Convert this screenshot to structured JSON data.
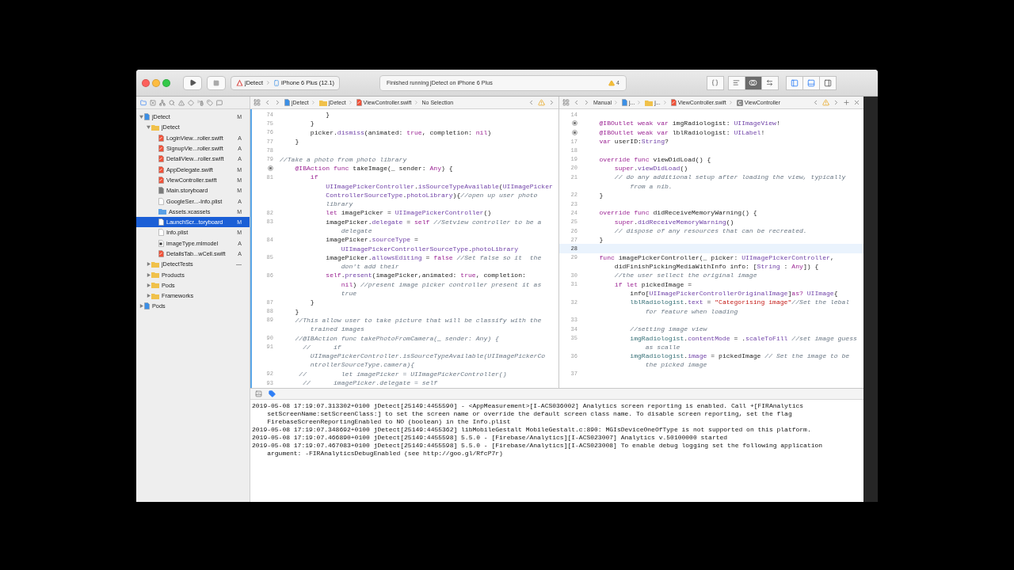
{
  "toolbar": {
    "scheme": "jDetect",
    "device": "iPhone 6 Plus (12.1)",
    "status": "Finished running jDetect on iPhone 6 Plus",
    "warnings": "4",
    "editor_modes": [
      {
        "kind": "standard",
        "selected": false
      },
      {
        "kind": "assistant",
        "selected": true
      },
      {
        "kind": "version",
        "selected": false
      }
    ],
    "panels": [
      {
        "kind": "navigator",
        "selected": true
      },
      {
        "kind": "debug",
        "selected": true
      },
      {
        "kind": "inspector",
        "selected": false
      }
    ]
  },
  "navigator": {
    "tabs": [
      {
        "kind": "project",
        "selected": true
      },
      {
        "kind": "source",
        "selected": false
      },
      {
        "kind": "symbol",
        "selected": false
      },
      {
        "kind": "find",
        "selected": false
      },
      {
        "kind": "issue",
        "selected": false
      },
      {
        "kind": "test",
        "selected": false
      },
      {
        "kind": "debug",
        "selected": false
      },
      {
        "kind": "breakpoint",
        "selected": false
      },
      {
        "kind": "report",
        "selected": false
      }
    ],
    "tree": [
      {
        "name": "jDetect",
        "kind": "project",
        "badge": "M",
        "expanded": true,
        "selected": false,
        "children": [
          {
            "name": "jDetect",
            "kind": "folder",
            "expanded": true,
            "selected": false,
            "children": [
              {
                "name": "LoginView...roller.swift",
                "kind": "swift",
                "badge": "A",
                "selected": false
              },
              {
                "name": "SignupVie...roller.swift",
                "kind": "swift",
                "badge": "A",
                "selected": false
              },
              {
                "name": "DetailView...roller.swift",
                "kind": "swift",
                "badge": "A",
                "selected": false
              },
              {
                "name": "AppDelegate.swift",
                "kind": "swift",
                "badge": "M",
                "selected": false
              },
              {
                "name": "ViewController.swift",
                "kind": "swift",
                "badge": "M",
                "selected": false
              },
              {
                "name": "Main.storyboard",
                "kind": "storyboard",
                "badge": "M",
                "selected": false
              },
              {
                "name": "GoogleSer...-Info.plist",
                "kind": "plist",
                "badge": "A",
                "selected": false
              },
              {
                "name": "Assets.xcassets",
                "kind": "assets",
                "badge": "M",
                "selected": false
              },
              {
                "name": "LaunchScr...toryboard",
                "kind": "plist",
                "badge": "M",
                "selected": true
              },
              {
                "name": "Info.plist",
                "kind": "plist",
                "badge": "M",
                "selected": false
              },
              {
                "name": "imageType.mlmodel",
                "kind": "mlmodel",
                "badge": "A",
                "selected": false
              },
              {
                "name": "DetailsTab...wCell.swift",
                "kind": "swift",
                "badge": "A",
                "selected": false
              }
            ]
          },
          {
            "name": "jDetectTests",
            "kind": "folder",
            "badge": "—",
            "expanded": false,
            "selected": false
          },
          {
            "name": "Products",
            "kind": "folder",
            "expanded": false,
            "selected": false
          },
          {
            "name": "Pods",
            "kind": "folder",
            "expanded": false,
            "selected": false
          },
          {
            "name": "Frameworks",
            "kind": "folder",
            "expanded": false,
            "selected": false
          }
        ]
      },
      {
        "name": "Pods",
        "kind": "project",
        "expanded": false,
        "selected": false
      }
    ]
  },
  "left_editor": {
    "jump_bar": [
      {
        "kind": "project",
        "label": "jDetect"
      },
      {
        "kind": "folder",
        "label": "jDetect"
      },
      {
        "kind": "swift",
        "label": "ViewController.swift"
      },
      {
        "kind": "none",
        "label": "No Selection"
      }
    ],
    "lines": [
      {
        "number": "74",
        "code": [
          {
            "kind": "p",
            "text": "            }"
          }
        ]
      },
      {
        "number": "75",
        "code": [
          {
            "kind": "p",
            "text": "        }"
          }
        ]
      },
      {
        "number": "76",
        "code": [
          {
            "kind": "p",
            "text": "        picker."
          },
          {
            "kind": "t",
            "text": "dismiss"
          },
          {
            "kind": "p",
            "text": "(animated: "
          },
          {
            "kind": "k",
            "text": "true"
          },
          {
            "kind": "p",
            "text": ", completion: "
          },
          {
            "kind": "k",
            "text": "nil"
          },
          {
            "kind": "p",
            "text": ")"
          }
        ]
      },
      {
        "number": "77",
        "code": [
          {
            "kind": "p",
            "text": "    }"
          }
        ]
      },
      {
        "number": "78"
      },
      {
        "number": "79",
        "code": [
          {
            "kind": "c",
            "text": "//Take a photo from photo library"
          }
        ]
      },
      {
        "kind": "outlet",
        "code": [
          {
            "kind": "k",
            "text": "    @IBAction func"
          },
          {
            "kind": "p",
            "text": " takeImage(_ sender: "
          },
          {
            "kind": "k",
            "text": "Any"
          },
          {
            "kind": "p",
            "text": ") {"
          }
        ]
      },
      {
        "number": "81",
        "code": [
          {
            "kind": "k",
            "text": "        if"
          }
        ]
      },
      {
        "code": [
          {
            "kind": "t",
            "text": "            UIImagePickerController"
          },
          {
            "kind": "p",
            "text": "."
          },
          {
            "kind": "t",
            "text": "isSourceTypeAvailable"
          },
          {
            "kind": "p",
            "text": "("
          },
          {
            "kind": "t",
            "text": "UIImagePicker"
          }
        ]
      },
      {
        "code": [
          {
            "kind": "t",
            "text": "            ControllerSourceType"
          },
          {
            "kind": "p",
            "text": "."
          },
          {
            "kind": "t",
            "text": "photoLibrary"
          },
          {
            "kind": "p",
            "text": "){"
          },
          {
            "kind": "c",
            "text": "//open up user photo"
          }
        ]
      },
      {
        "code": [
          {
            "kind": "c",
            "text": "            library"
          }
        ]
      },
      {
        "number": "82",
        "code": [
          {
            "kind": "k",
            "text": "            let"
          },
          {
            "kind": "p",
            "text": " imagePicker = "
          },
          {
            "kind": "t",
            "text": "UIImagePickerController"
          },
          {
            "kind": "p",
            "text": "()"
          }
        ]
      },
      {
        "number": "83",
        "code": [
          {
            "kind": "p",
            "text": "            imagePicker."
          },
          {
            "kind": "t",
            "text": "delegate"
          },
          {
            "kind": "p",
            "text": " = "
          },
          {
            "kind": "k",
            "text": "self"
          },
          {
            "kind": "c",
            "text": " //Setview controller to be a"
          }
        ]
      },
      {
        "code": [
          {
            "kind": "c",
            "text": "                delegate"
          }
        ]
      },
      {
        "number": "84",
        "code": [
          {
            "kind": "p",
            "text": "            imagePicker."
          },
          {
            "kind": "t",
            "text": "sourceType"
          },
          {
            "kind": "p",
            "text": " ="
          }
        ]
      },
      {
        "code": [
          {
            "kind": "t",
            "text": "                UIImagePickerControllerSourceType"
          },
          {
            "kind": "p",
            "text": "."
          },
          {
            "kind": "t",
            "text": "photoLibrary"
          }
        ]
      },
      {
        "number": "85",
        "code": [
          {
            "kind": "p",
            "text": "            imagePicker."
          },
          {
            "kind": "t",
            "text": "allowsEditing"
          },
          {
            "kind": "p",
            "text": " = "
          },
          {
            "kind": "k",
            "text": "false"
          },
          {
            "kind": "c",
            "text": " //Set false so it  the"
          }
        ]
      },
      {
        "code": [
          {
            "kind": "c",
            "text": "                don't add their"
          }
        ]
      },
      {
        "number": "86",
        "code": [
          {
            "kind": "k",
            "text": "            self"
          },
          {
            "kind": "p",
            "text": "."
          },
          {
            "kind": "t",
            "text": "present"
          },
          {
            "kind": "p",
            "text": "(imagePicker,animated: "
          },
          {
            "kind": "k",
            "text": "true"
          },
          {
            "kind": "p",
            "text": ", completion:"
          }
        ]
      },
      {
        "code": [
          {
            "kind": "k",
            "text": "                nil"
          },
          {
            "kind": "p",
            "text": ")"
          },
          {
            "kind": "c",
            "text": " //present image picker controller present it as"
          }
        ]
      },
      {
        "code": [
          {
            "kind": "c",
            "text": "                true"
          }
        ]
      },
      {
        "number": "87",
        "code": [
          {
            "kind": "p",
            "text": "        }"
          }
        ]
      },
      {
        "number": "88",
        "code": [
          {
            "kind": "p",
            "text": "    }"
          }
        ]
      },
      {
        "number": "89",
        "code": [
          {
            "kind": "c",
            "text": "    //This allow user to take picture that will be classify with the"
          }
        ]
      },
      {
        "code": [
          {
            "kind": "c",
            "text": "        trained images"
          }
        ]
      },
      {
        "number": "90",
        "code": [
          {
            "kind": "c",
            "text": "    //@IBAction func takePhotoFromCamera(_ sender: Any) {"
          }
        ]
      },
      {
        "number": "91",
        "code": [
          {
            "kind": "c",
            "text": "      //      if"
          }
        ]
      },
      {
        "code": [
          {
            "kind": "c",
            "text": "        UIImagePickerController.isSourceTypeAvailable(UIImagePickerCo"
          }
        ]
      },
      {
        "code": [
          {
            "kind": "c",
            "text": "        ntrollerSourceType.camera){"
          }
        ]
      },
      {
        "number": "92",
        "code": [
          {
            "kind": "c",
            "text": "     //         let imagePicker = UIImagePickerController()"
          }
        ]
      },
      {
        "number": "93",
        "code": [
          {
            "kind": "c",
            "text": "      //      imagePicker.delegate = self"
          }
        ]
      }
    ]
  },
  "right_editor": {
    "jump_bar": [
      {
        "kind": "none",
        "label": "Manual"
      },
      {
        "kind": "project",
        "label": "j..."
      },
      {
        "kind": "folder",
        "label": "j..."
      },
      {
        "kind": "swift",
        "label": "ViewController.swift"
      },
      {
        "kind": "class",
        "label": "ViewController"
      }
    ],
    "lines": [
      {
        "number": "14"
      },
      {
        "kind": "outlet",
        "code": [
          {
            "kind": "k",
            "text": "    @IBOutlet weak var"
          },
          {
            "kind": "p",
            "text": " imgRadiologist: "
          },
          {
            "kind": "t",
            "text": "UIImageView"
          },
          {
            "kind": "p",
            "text": "!"
          }
        ]
      },
      {
        "kind": "outlet",
        "code": [
          {
            "kind": "k",
            "text": "    @IBOutlet weak var"
          },
          {
            "kind": "p",
            "text": " lblRadiologist: "
          },
          {
            "kind": "t",
            "text": "UILabel"
          },
          {
            "kind": "p",
            "text": "!"
          }
        ]
      },
      {
        "number": "17",
        "code": [
          {
            "kind": "k",
            "text": "    var"
          },
          {
            "kind": "p",
            "text": " userID:"
          },
          {
            "kind": "t",
            "text": "String"
          },
          {
            "kind": "p",
            "text": "?"
          }
        ]
      },
      {
        "number": "18"
      },
      {
        "number": "19",
        "code": [
          {
            "kind": "k",
            "text": "    override func"
          },
          {
            "kind": "p",
            "text": " viewDidLoad() {"
          }
        ]
      },
      {
        "number": "20",
        "code": [
          {
            "kind": "k",
            "text": "        super"
          },
          {
            "kind": "p",
            "text": "."
          },
          {
            "kind": "t",
            "text": "viewDidLoad"
          },
          {
            "kind": "p",
            "text": "()"
          }
        ]
      },
      {
        "number": "21",
        "code": [
          {
            "kind": "c",
            "text": "        // do any additional setup after loading the view, typically"
          }
        ]
      },
      {
        "code": [
          {
            "kind": "c",
            "text": "            from a nib."
          }
        ]
      },
      {
        "number": "22",
        "code": [
          {
            "kind": "p",
            "text": "    }"
          }
        ]
      },
      {
        "number": "23"
      },
      {
        "number": "24",
        "code": [
          {
            "kind": "k",
            "text": "    override func"
          },
          {
            "kind": "p",
            "text": " didReceiveMemoryWarning() {"
          }
        ]
      },
      {
        "number": "25",
        "code": [
          {
            "kind": "k",
            "text": "        super"
          },
          {
            "kind": "p",
            "text": "."
          },
          {
            "kind": "t",
            "text": "didReceiveMemoryWarning"
          },
          {
            "kind": "p",
            "text": "()"
          }
        ]
      },
      {
        "number": "26",
        "code": [
          {
            "kind": "c",
            "text": "        // dispose of any resources that can be recreated."
          }
        ]
      },
      {
        "number": "27",
        "code": [
          {
            "kind": "p",
            "text": "    }"
          }
        ]
      },
      {
        "number": "28",
        "current": true
      },
      {
        "number": "29",
        "code": [
          {
            "kind": "k",
            "text": "    func"
          },
          {
            "kind": "p",
            "text": " imagePickerController(_ picker: "
          },
          {
            "kind": "t",
            "text": "UIImagePickerController"
          },
          {
            "kind": "p",
            "text": ","
          }
        ]
      },
      {
        "code": [
          {
            "kind": "p",
            "text": "        didFinishPickingMediaWithInfo info: ["
          },
          {
            "kind": "t",
            "text": "String"
          },
          {
            "kind": "p",
            "text": " : "
          },
          {
            "kind": "k",
            "text": "Any"
          },
          {
            "kind": "p",
            "text": "]) {"
          }
        ]
      },
      {
        "number": "30",
        "code": [
          {
            "kind": "c",
            "text": "        //the user sellect the original image"
          }
        ]
      },
      {
        "number": "31",
        "code": [
          {
            "kind": "k",
            "text": "        if let"
          },
          {
            "kind": "p",
            "text": " pickedImage ="
          }
        ]
      },
      {
        "code": [
          {
            "kind": "p",
            "text": "            info["
          },
          {
            "kind": "t",
            "text": "UIImagePickerControllerOriginalImage"
          },
          {
            "kind": "p",
            "text": "]"
          },
          {
            "kind": "k",
            "text": "as?"
          },
          {
            "kind": "t",
            "text": " UIImage"
          },
          {
            "kind": "p",
            "text": "{"
          }
        ]
      },
      {
        "number": "32",
        "code": [
          {
            "kind": "m",
            "text": "            lblRadiologist"
          },
          {
            "kind": "p",
            "text": "."
          },
          {
            "kind": "t",
            "text": "text"
          },
          {
            "kind": "p",
            "text": " = "
          },
          {
            "kind": "s",
            "text": "\"Categorising image\""
          },
          {
            "kind": "c",
            "text": "//Set the lebal"
          }
        ]
      },
      {
        "code": [
          {
            "kind": "c",
            "text": "                for feature when loading"
          }
        ]
      },
      {
        "number": "33"
      },
      {
        "number": "34",
        "code": [
          {
            "kind": "c",
            "text": "            //setting image view"
          }
        ]
      },
      {
        "number": "35",
        "code": [
          {
            "kind": "m",
            "text": "            imgRadiologist"
          },
          {
            "kind": "p",
            "text": "."
          },
          {
            "kind": "t",
            "text": "contentMode"
          },
          {
            "kind": "p",
            "text": " = ."
          },
          {
            "kind": "t",
            "text": "scaleToFill"
          },
          {
            "kind": "c",
            "text": " //set image guess"
          }
        ]
      },
      {
        "code": [
          {
            "kind": "c",
            "text": "                as scalle"
          }
        ]
      },
      {
        "number": "36",
        "code": [
          {
            "kind": "m",
            "text": "            imgRadiologist"
          },
          {
            "kind": "p",
            "text": "."
          },
          {
            "kind": "t",
            "text": "image"
          },
          {
            "kind": "p",
            "text": " = pickedImage "
          },
          {
            "kind": "c",
            "text": "// Set the image to be"
          }
        ]
      },
      {
        "code": [
          {
            "kind": "c",
            "text": "                the picked image"
          }
        ]
      },
      {
        "number": "37"
      }
    ]
  },
  "console": [
    "2019-05-08 17:19:07.313302+0100 jDetect[25149:4455590]  - <AppMeasurement>[I-ACS036002] Analytics screen reporting is enabled. Call +[FIRAnalytics setScreenName:setScreenClass:] to set the screen name or override the default screen class name. To disable screen reporting, set the flag FirebaseScreenReportingEnabled to NO (boolean) in the Info.plist",
    "2019-05-08 17:19:07.348692+0100 jDetect[25149:4455362] libMobileGestalt MobileGestalt.c:890: MGIsDeviceOneOfType is not supported on this platform.",
    "2019-05-08 17:19:07.466890+0100 jDetect[25149:4455598] 5.5.0 - [Firebase/Analytics][I-ACS023007] Analytics v.50100000 started",
    "2019-05-08 17:19:07.467083+0100 jDetect[25149:4455598] 5.5.0 - [Firebase/Analytics][I-ACS023008] To enable debug logging set the following application argument: -FIRAnalyticsDebugEnabled (see http://goo.gl/RfcP7r)"
  ]
}
